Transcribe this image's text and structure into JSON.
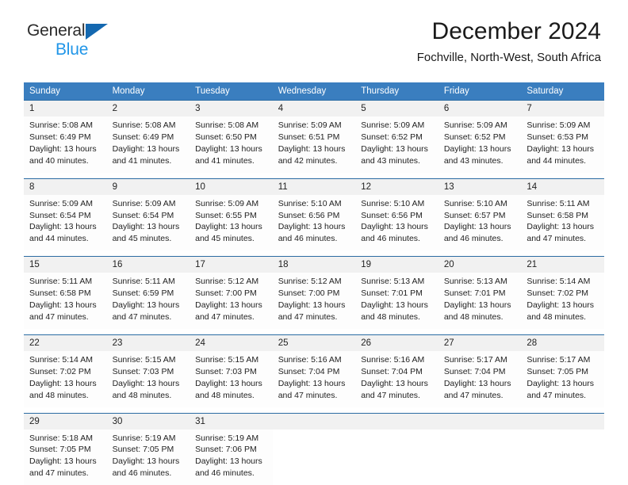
{
  "brand": {
    "name_top": "General",
    "name_bottom": "Blue",
    "logo_icon": "triangle-flag-icon",
    "accent_color": "#1468b0",
    "accent_color_light": "#2196e8"
  },
  "header": {
    "title": "December 2024",
    "subtitle": "Fochville, North-West, South Africa"
  },
  "calendar": {
    "header_bg": "#3a7ebf",
    "daynum_bg": "#f1f1f1",
    "weekday_headers": [
      "Sunday",
      "Monday",
      "Tuesday",
      "Wednesday",
      "Thursday",
      "Friday",
      "Saturday"
    ],
    "weeks": [
      [
        {
          "day": "1",
          "sunrise": "Sunrise: 5:08 AM",
          "sunset": "Sunset: 6:49 PM",
          "daylight_1": "Daylight: 13 hours",
          "daylight_2": "and 40 minutes."
        },
        {
          "day": "2",
          "sunrise": "Sunrise: 5:08 AM",
          "sunset": "Sunset: 6:49 PM",
          "daylight_1": "Daylight: 13 hours",
          "daylight_2": "and 41 minutes."
        },
        {
          "day": "3",
          "sunrise": "Sunrise: 5:08 AM",
          "sunset": "Sunset: 6:50 PM",
          "daylight_1": "Daylight: 13 hours",
          "daylight_2": "and 41 minutes."
        },
        {
          "day": "4",
          "sunrise": "Sunrise: 5:09 AM",
          "sunset": "Sunset: 6:51 PM",
          "daylight_1": "Daylight: 13 hours",
          "daylight_2": "and 42 minutes."
        },
        {
          "day": "5",
          "sunrise": "Sunrise: 5:09 AM",
          "sunset": "Sunset: 6:52 PM",
          "daylight_1": "Daylight: 13 hours",
          "daylight_2": "and 43 minutes."
        },
        {
          "day": "6",
          "sunrise": "Sunrise: 5:09 AM",
          "sunset": "Sunset: 6:52 PM",
          "daylight_1": "Daylight: 13 hours",
          "daylight_2": "and 43 minutes."
        },
        {
          "day": "7",
          "sunrise": "Sunrise: 5:09 AM",
          "sunset": "Sunset: 6:53 PM",
          "daylight_1": "Daylight: 13 hours",
          "daylight_2": "and 44 minutes."
        }
      ],
      [
        {
          "day": "8",
          "sunrise": "Sunrise: 5:09 AM",
          "sunset": "Sunset: 6:54 PM",
          "daylight_1": "Daylight: 13 hours",
          "daylight_2": "and 44 minutes."
        },
        {
          "day": "9",
          "sunrise": "Sunrise: 5:09 AM",
          "sunset": "Sunset: 6:54 PM",
          "daylight_1": "Daylight: 13 hours",
          "daylight_2": "and 45 minutes."
        },
        {
          "day": "10",
          "sunrise": "Sunrise: 5:09 AM",
          "sunset": "Sunset: 6:55 PM",
          "daylight_1": "Daylight: 13 hours",
          "daylight_2": "and 45 minutes."
        },
        {
          "day": "11",
          "sunrise": "Sunrise: 5:10 AM",
          "sunset": "Sunset: 6:56 PM",
          "daylight_1": "Daylight: 13 hours",
          "daylight_2": "and 46 minutes."
        },
        {
          "day": "12",
          "sunrise": "Sunrise: 5:10 AM",
          "sunset": "Sunset: 6:56 PM",
          "daylight_1": "Daylight: 13 hours",
          "daylight_2": "and 46 minutes."
        },
        {
          "day": "13",
          "sunrise": "Sunrise: 5:10 AM",
          "sunset": "Sunset: 6:57 PM",
          "daylight_1": "Daylight: 13 hours",
          "daylight_2": "and 46 minutes."
        },
        {
          "day": "14",
          "sunrise": "Sunrise: 5:11 AM",
          "sunset": "Sunset: 6:58 PM",
          "daylight_1": "Daylight: 13 hours",
          "daylight_2": "and 47 minutes."
        }
      ],
      [
        {
          "day": "15",
          "sunrise": "Sunrise: 5:11 AM",
          "sunset": "Sunset: 6:58 PM",
          "daylight_1": "Daylight: 13 hours",
          "daylight_2": "and 47 minutes."
        },
        {
          "day": "16",
          "sunrise": "Sunrise: 5:11 AM",
          "sunset": "Sunset: 6:59 PM",
          "daylight_1": "Daylight: 13 hours",
          "daylight_2": "and 47 minutes."
        },
        {
          "day": "17",
          "sunrise": "Sunrise: 5:12 AM",
          "sunset": "Sunset: 7:00 PM",
          "daylight_1": "Daylight: 13 hours",
          "daylight_2": "and 47 minutes."
        },
        {
          "day": "18",
          "sunrise": "Sunrise: 5:12 AM",
          "sunset": "Sunset: 7:00 PM",
          "daylight_1": "Daylight: 13 hours",
          "daylight_2": "and 47 minutes."
        },
        {
          "day": "19",
          "sunrise": "Sunrise: 5:13 AM",
          "sunset": "Sunset: 7:01 PM",
          "daylight_1": "Daylight: 13 hours",
          "daylight_2": "and 48 minutes."
        },
        {
          "day": "20",
          "sunrise": "Sunrise: 5:13 AM",
          "sunset": "Sunset: 7:01 PM",
          "daylight_1": "Daylight: 13 hours",
          "daylight_2": "and 48 minutes."
        },
        {
          "day": "21",
          "sunrise": "Sunrise: 5:14 AM",
          "sunset": "Sunset: 7:02 PM",
          "daylight_1": "Daylight: 13 hours",
          "daylight_2": "and 48 minutes."
        }
      ],
      [
        {
          "day": "22",
          "sunrise": "Sunrise: 5:14 AM",
          "sunset": "Sunset: 7:02 PM",
          "daylight_1": "Daylight: 13 hours",
          "daylight_2": "and 48 minutes."
        },
        {
          "day": "23",
          "sunrise": "Sunrise: 5:15 AM",
          "sunset": "Sunset: 7:03 PM",
          "daylight_1": "Daylight: 13 hours",
          "daylight_2": "and 48 minutes."
        },
        {
          "day": "24",
          "sunrise": "Sunrise: 5:15 AM",
          "sunset": "Sunset: 7:03 PM",
          "daylight_1": "Daylight: 13 hours",
          "daylight_2": "and 48 minutes."
        },
        {
          "day": "25",
          "sunrise": "Sunrise: 5:16 AM",
          "sunset": "Sunset: 7:04 PM",
          "daylight_1": "Daylight: 13 hours",
          "daylight_2": "and 47 minutes."
        },
        {
          "day": "26",
          "sunrise": "Sunrise: 5:16 AM",
          "sunset": "Sunset: 7:04 PM",
          "daylight_1": "Daylight: 13 hours",
          "daylight_2": "and 47 minutes."
        },
        {
          "day": "27",
          "sunrise": "Sunrise: 5:17 AM",
          "sunset": "Sunset: 7:04 PM",
          "daylight_1": "Daylight: 13 hours",
          "daylight_2": "and 47 minutes."
        },
        {
          "day": "28",
          "sunrise": "Sunrise: 5:17 AM",
          "sunset": "Sunset: 7:05 PM",
          "daylight_1": "Daylight: 13 hours",
          "daylight_2": "and 47 minutes."
        }
      ],
      [
        {
          "day": "29",
          "sunrise": "Sunrise: 5:18 AM",
          "sunset": "Sunset: 7:05 PM",
          "daylight_1": "Daylight: 13 hours",
          "daylight_2": "and 47 minutes."
        },
        {
          "day": "30",
          "sunrise": "Sunrise: 5:19 AM",
          "sunset": "Sunset: 7:05 PM",
          "daylight_1": "Daylight: 13 hours",
          "daylight_2": "and 46 minutes."
        },
        {
          "day": "31",
          "sunrise": "Sunrise: 5:19 AM",
          "sunset": "Sunset: 7:06 PM",
          "daylight_1": "Daylight: 13 hours",
          "daylight_2": "and 46 minutes."
        },
        {
          "day": "",
          "sunrise": "",
          "sunset": "",
          "daylight_1": "",
          "daylight_2": ""
        },
        {
          "day": "",
          "sunrise": "",
          "sunset": "",
          "daylight_1": "",
          "daylight_2": ""
        },
        {
          "day": "",
          "sunrise": "",
          "sunset": "",
          "daylight_1": "",
          "daylight_2": ""
        },
        {
          "day": "",
          "sunrise": "",
          "sunset": "",
          "daylight_1": "",
          "daylight_2": ""
        }
      ]
    ]
  }
}
